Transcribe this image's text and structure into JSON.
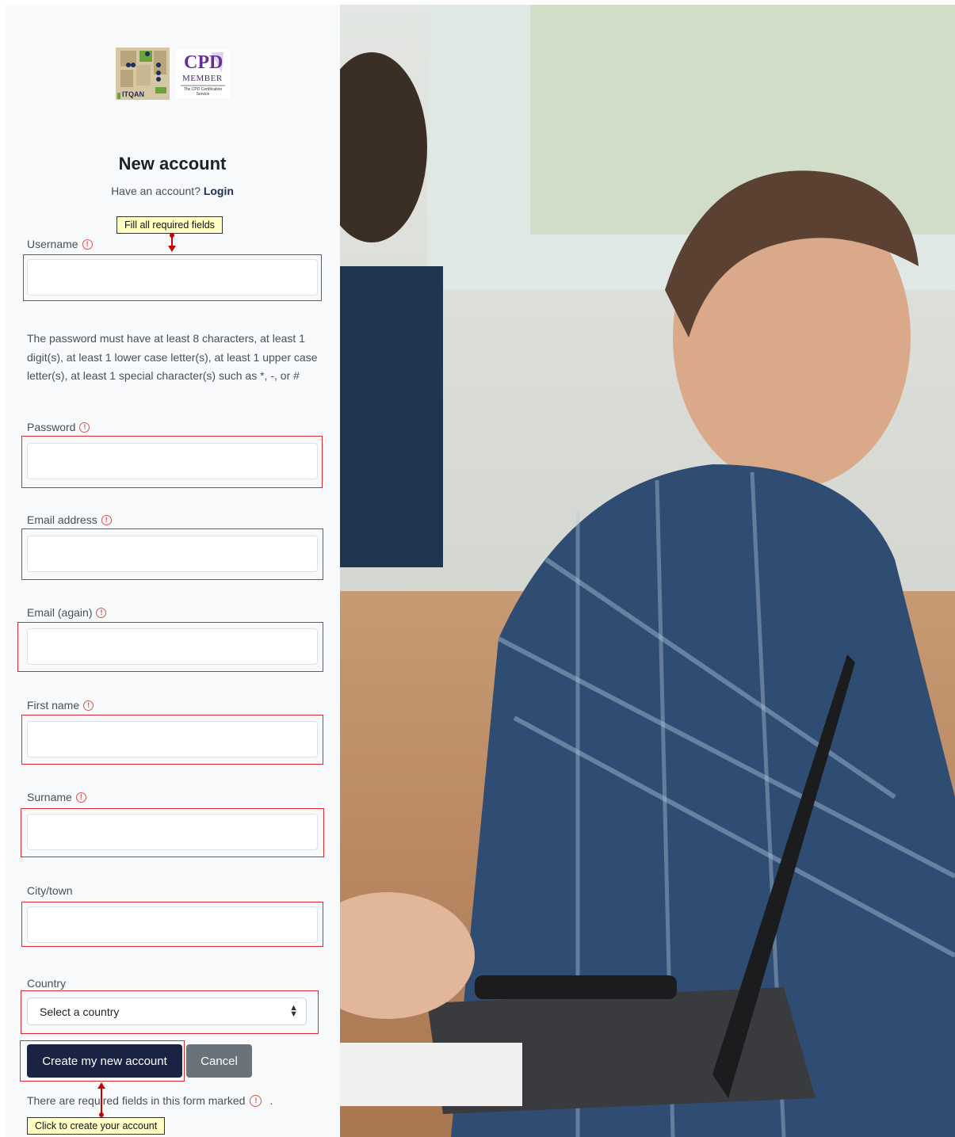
{
  "header": {
    "logo_itqan_text": "ITQAN",
    "logo_cpd_text": "CPD",
    "logo_cpd_sub": "MEMBER",
    "logo_cpd_caption": "The CPD Certification Service"
  },
  "title": "New account",
  "login_prompt": {
    "text": "Have an account?",
    "link": "Login"
  },
  "callouts": {
    "required": "Fill all required fields",
    "create": "Click to create your account"
  },
  "fields": {
    "username": {
      "label": "Username",
      "value": ""
    },
    "password_note": "The password must have at least 8 characters, at least 1 digit(s), at least 1 lower case letter(s), at least 1 upper case letter(s), at least 1 special character(s) such as *, -, or #",
    "password": {
      "label": "Password",
      "value": ""
    },
    "email": {
      "label": "Email address",
      "value": ""
    },
    "email_again": {
      "label": "Email (again)",
      "value": ""
    },
    "first_name": {
      "label": "First name",
      "value": ""
    },
    "surname": {
      "label": "Surname",
      "value": ""
    },
    "city": {
      "label": "City/town",
      "value": ""
    },
    "country": {
      "label": "Country",
      "selected": "Select a country"
    }
  },
  "buttons": {
    "create": "Create my new account",
    "cancel": "Cancel"
  },
  "footer": {
    "required_note": "There are required fields in this form marked",
    "period": "."
  },
  "colors": {
    "highlight": "#e0292f",
    "primary": "#1b2345",
    "cancel": "#6a727a",
    "required_icon": "#d9534f"
  },
  "icons": {
    "required": "exclamation-circle-icon",
    "select_caret": "updown-caret-icon"
  }
}
